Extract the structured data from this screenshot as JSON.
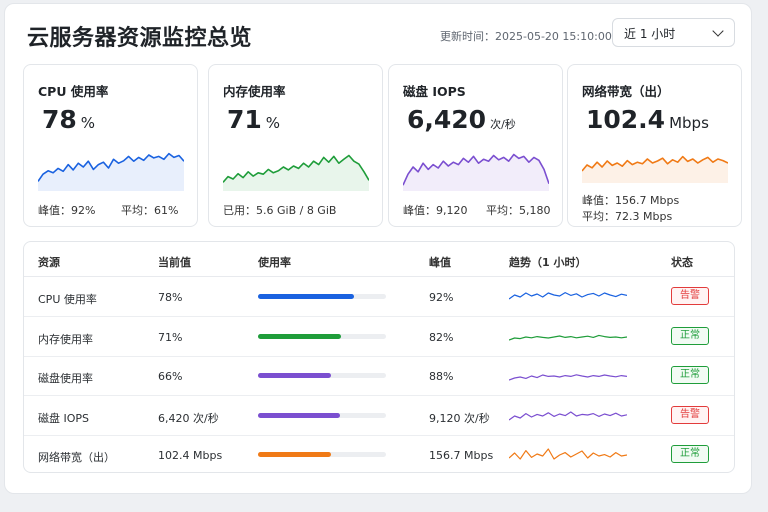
{
  "header": {
    "title": "云服务器资源监控总览",
    "updated": "更新时间：2025-05-20 15:10:00",
    "range": "近 1 小时"
  },
  "colors": {
    "cpu": "#1a62e0",
    "memory": "#1f9d3a",
    "disk": "#7b4fd0",
    "network": "#f07a16",
    "alert": "#e23b3b",
    "normal": "#1f9d3a"
  },
  "cards": [
    {
      "title": "CPU 使用率",
      "value": "78",
      "unit": "%",
      "foot1": "峰值：92%",
      "foot2": "平均：61%",
      "spark": [
        0.2,
        0.35,
        0.42,
        0.38,
        0.47,
        0.41,
        0.55,
        0.44,
        0.58,
        0.5,
        0.62,
        0.45,
        0.55,
        0.6,
        0.48,
        0.66,
        0.58,
        0.63,
        0.72,
        0.62,
        0.7,
        0.64,
        0.75,
        0.69,
        0.72,
        0.66,
        0.78,
        0.7,
        0.74,
        0.62
      ]
    },
    {
      "title": "内存使用率",
      "value": "71",
      "unit": "%",
      "foot1": "已用：5.6 GiB / 8 GiB",
      "foot2": "",
      "spark": [
        0.18,
        0.3,
        0.25,
        0.36,
        0.28,
        0.4,
        0.31,
        0.38,
        0.35,
        0.45,
        0.38,
        0.42,
        0.5,
        0.44,
        0.52,
        0.47,
        0.58,
        0.5,
        0.62,
        0.55,
        0.7,
        0.6,
        0.72,
        0.58,
        0.66,
        0.74,
        0.62,
        0.56,
        0.4,
        0.22
      ]
    },
    {
      "title": "磁盘 IOPS",
      "value": "6,420",
      "unit": "次/秒",
      "foot1": "峰值：9,120",
      "foot2": "平均：5,180",
      "spark": [
        0.12,
        0.35,
        0.5,
        0.4,
        0.58,
        0.45,
        0.55,
        0.48,
        0.62,
        0.52,
        0.6,
        0.55,
        0.68,
        0.6,
        0.72,
        0.58,
        0.66,
        0.62,
        0.74,
        0.65,
        0.7,
        0.62,
        0.76,
        0.68,
        0.72,
        0.6,
        0.7,
        0.64,
        0.45,
        0.15
      ]
    },
    {
      "title": "网络带宽（出）",
      "value": "102.4",
      "unit": "Mbps",
      "foot1": "峰值：156.7 Mbps",
      "foot2": "平均：72.3 Mbps",
      "spark": [
        0.3,
        0.45,
        0.38,
        0.52,
        0.4,
        0.55,
        0.44,
        0.5,
        0.42,
        0.56,
        0.46,
        0.52,
        0.48,
        0.6,
        0.5,
        0.55,
        0.62,
        0.48,
        0.58,
        0.52,
        0.66,
        0.54,
        0.6,
        0.5,
        0.58,
        0.64,
        0.52,
        0.6,
        0.56,
        0.5
      ]
    }
  ],
  "table": {
    "headers": [
      "资源",
      "当前值",
      "使用率",
      "峰值",
      "趋势（1 小时）",
      "状态"
    ],
    "rows": [
      {
        "name": "CPU 使用率",
        "current": "78%",
        "usage": 0.75,
        "peak": "92%",
        "status": "告警",
        "level": "alert",
        "trend": [
          0.4,
          0.6,
          0.5,
          0.7,
          0.55,
          0.65,
          0.5,
          0.7,
          0.6,
          0.55,
          0.72,
          0.58,
          0.66,
          0.5,
          0.62,
          0.68,
          0.55,
          0.7,
          0.6,
          0.52,
          0.64,
          0.58
        ]
      },
      {
        "name": "内存使用率",
        "current": "71%",
        "usage": 0.65,
        "peak": "82%",
        "status": "正常",
        "level": "normal",
        "trend": [
          0.35,
          0.45,
          0.42,
          0.5,
          0.46,
          0.52,
          0.48,
          0.45,
          0.5,
          0.55,
          0.48,
          0.52,
          0.46,
          0.5,
          0.54,
          0.48,
          0.58,
          0.52,
          0.48,
          0.5,
          0.46,
          0.5
        ]
      },
      {
        "name": "磁盘使用率",
        "current": "66%",
        "usage": 0.57,
        "peak": "88%",
        "status": "正常",
        "level": "normal",
        "trend": [
          0.3,
          0.4,
          0.45,
          0.38,
          0.5,
          0.42,
          0.55,
          0.48,
          0.5,
          0.45,
          0.52,
          0.48,
          0.56,
          0.5,
          0.45,
          0.52,
          0.48,
          0.55,
          0.5,
          0.46,
          0.52,
          0.48
        ]
      },
      {
        "name": "磁盘 IOPS",
        "current": "6,420 次/秒",
        "usage": 0.64,
        "peak": "9,120 次/秒",
        "status": "告警",
        "level": "alert",
        "trend": [
          0.3,
          0.5,
          0.4,
          0.62,
          0.45,
          0.58,
          0.5,
          0.66,
          0.48,
          0.6,
          0.52,
          0.7,
          0.5,
          0.58,
          0.55,
          0.62,
          0.48,
          0.6,
          0.52,
          0.64,
          0.5,
          0.56
        ]
      },
      {
        "name": "网络带宽（出）",
        "current": "102.4 Mbps",
        "usage": 0.57,
        "peak": "156.7 Mbps",
        "status": "正常",
        "level": "normal",
        "trend": [
          0.35,
          0.6,
          0.3,
          0.72,
          0.38,
          0.55,
          0.45,
          0.8,
          0.3,
          0.5,
          0.62,
          0.4,
          0.55,
          0.7,
          0.35,
          0.6,
          0.45,
          0.52,
          0.4,
          0.62,
          0.45,
          0.5
        ]
      }
    ]
  }
}
